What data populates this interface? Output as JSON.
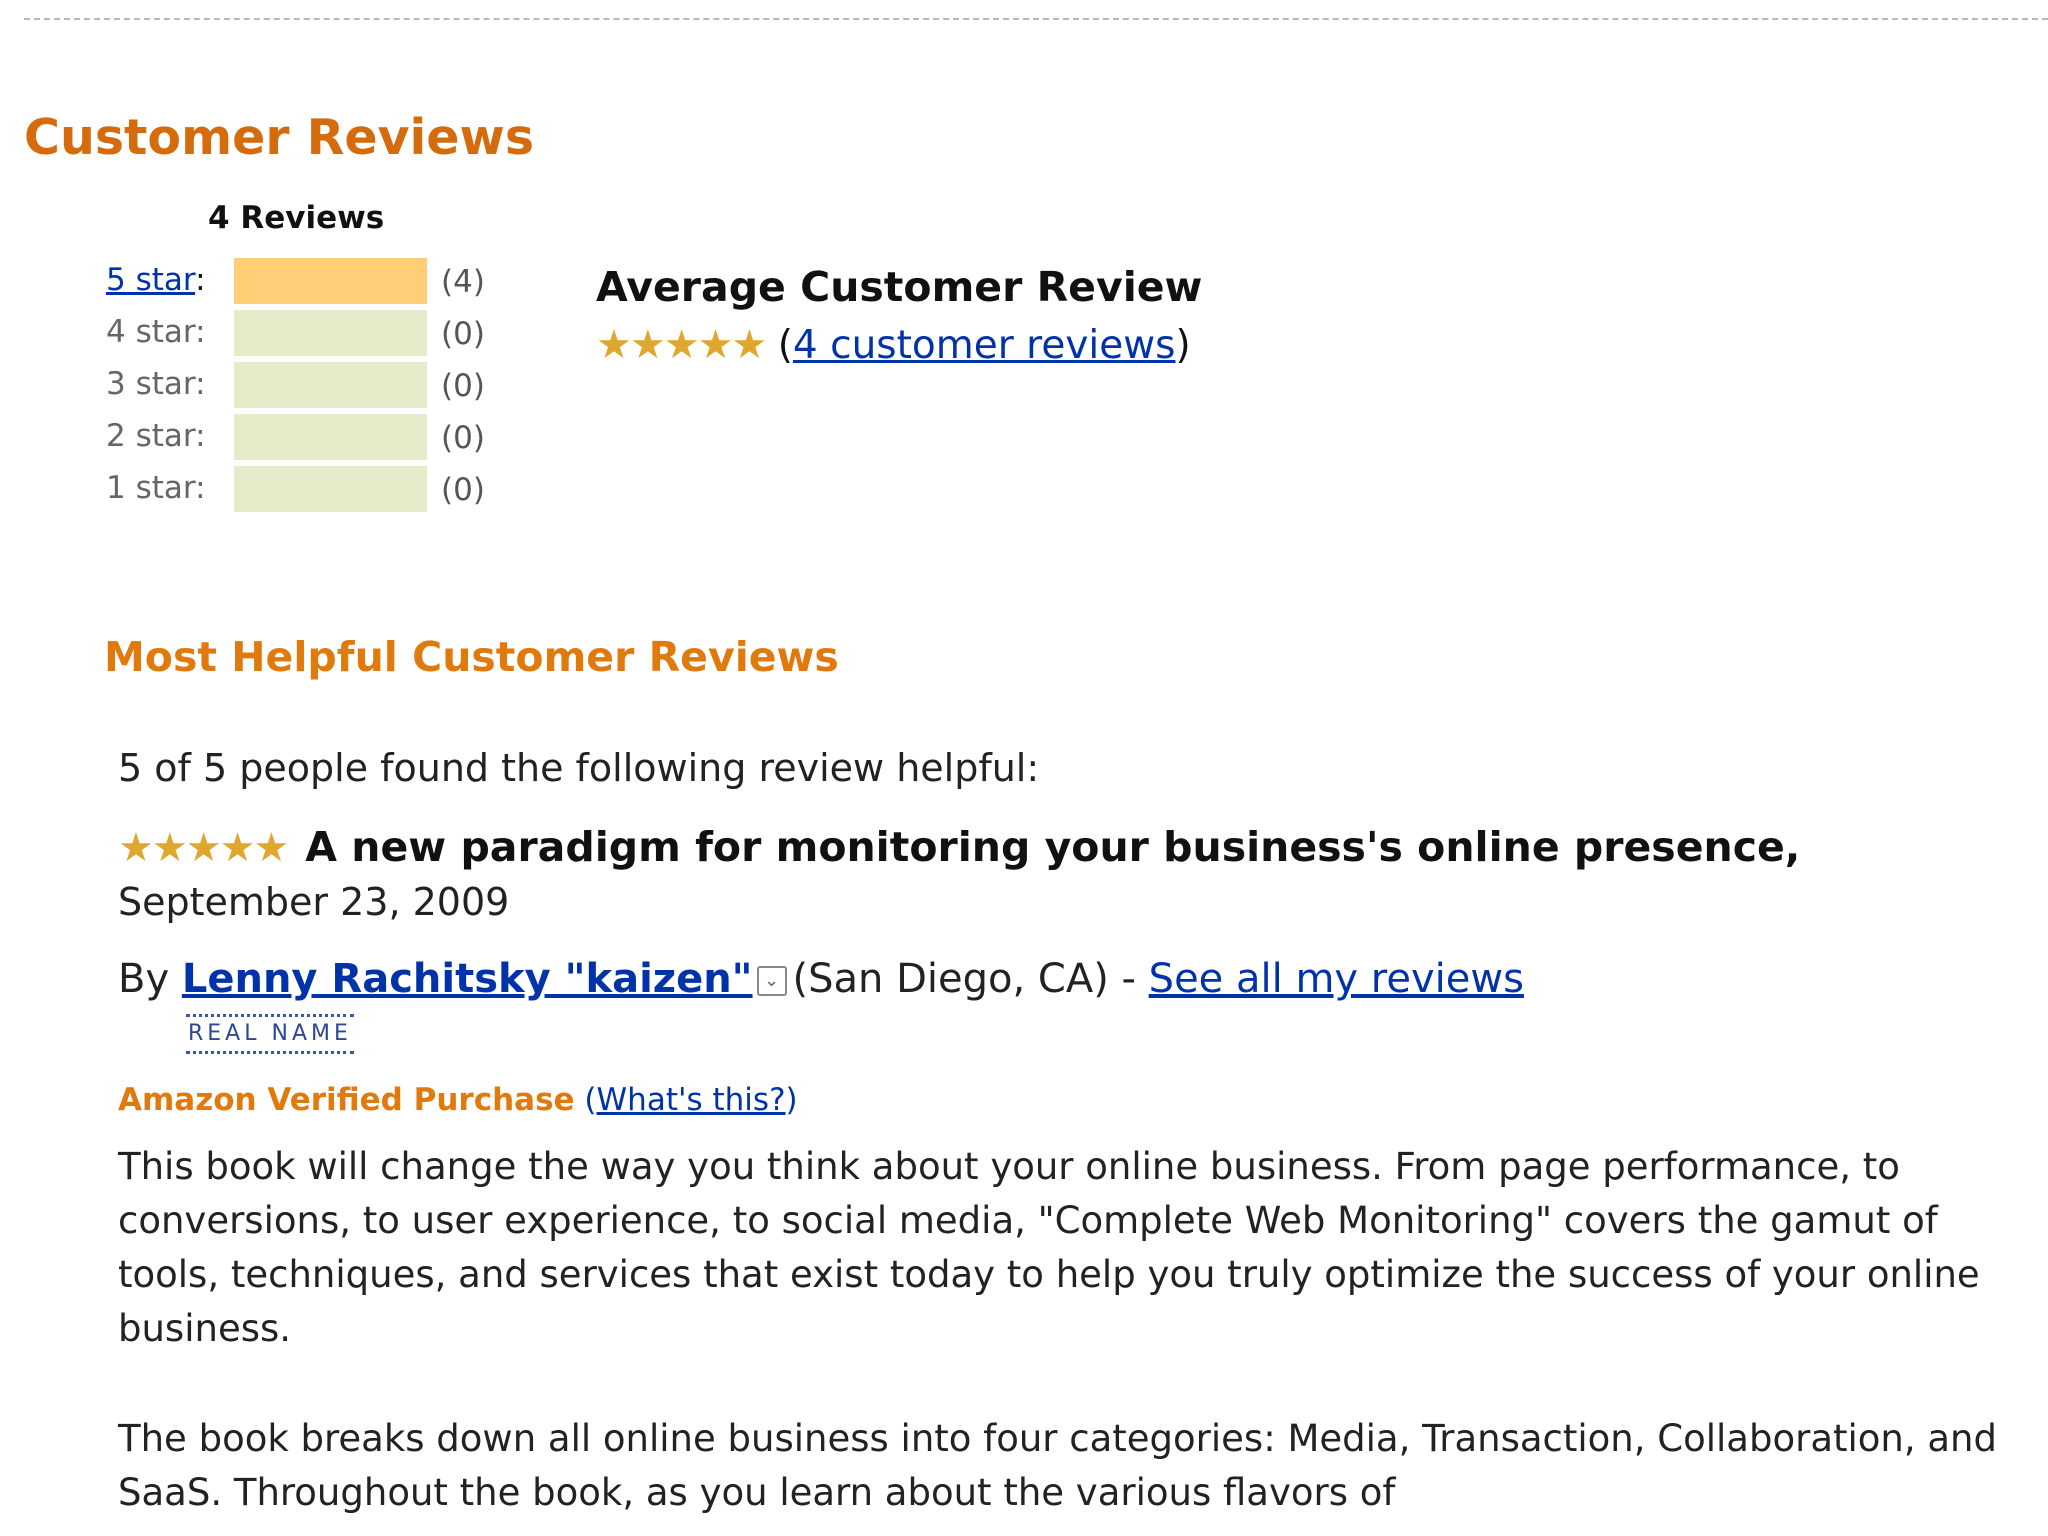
{
  "section_title": "Customer Reviews",
  "review_count_label": "4 Reviews",
  "histogram": [
    {
      "label": "5 star",
      "count_text": "(4)",
      "fraction": 1.0,
      "link": true
    },
    {
      "label": "4 star",
      "count_text": "(0)",
      "fraction": 0.0,
      "link": false
    },
    {
      "label": "3 star",
      "count_text": "(0)",
      "fraction": 0.0,
      "link": false
    },
    {
      "label": "2 star",
      "count_text": "(0)",
      "fraction": 0.0,
      "link": false
    },
    {
      "label": "1 star",
      "count_text": "(0)",
      "fraction": 0.0,
      "link": false
    }
  ],
  "average": {
    "title": "Average Customer Review",
    "stars": "★★★★★",
    "rating_value": 5,
    "reviews_link": "4 customer reviews"
  },
  "most_helpful_title": "Most Helpful Customer Reviews",
  "review": {
    "helpful_text": "5 of 5 people found the following review helpful:",
    "stars": "★★★★★",
    "rating_value": 5,
    "title": "A new paradigm for monitoring your business's online presence,",
    "date": "September 23, 2009",
    "by_prefix": "By",
    "author": "Lenny Rachitsky \"kaizen\"",
    "location": "(San Diego, CA) -",
    "see_all": "See all my reviews",
    "real_name_badge": "REAL NAME",
    "verified_label": "Amazon Verified Purchase",
    "whats_this": "What's this?",
    "paragraph1": "This book will change the way you think about your online business. From page performance, to conversions, to user experience, to social media, \"Complete Web Monitoring\" covers the gamut of tools, techniques, and services that exist today to help you truly optimize the success of your online business.",
    "paragraph2": "The book breaks down all online business into four categories: Media, Transaction, Collaboration, and SaaS. Throughout the book, as you learn about the various flavors of"
  },
  "colors": {
    "heading_orange": "#d46b0c",
    "link_blue": "#0033aa",
    "bar_fill": "#ffce76",
    "bar_track": "#e6ebc9",
    "star_gold": "#e0a72e"
  }
}
